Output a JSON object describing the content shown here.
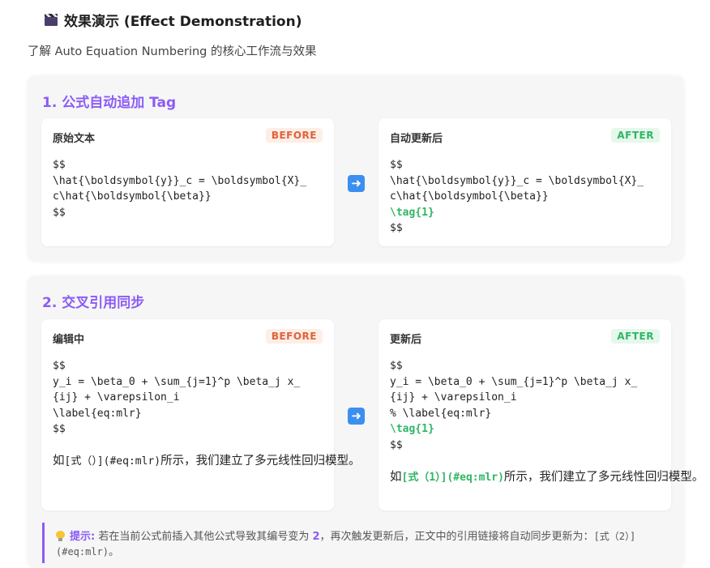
{
  "header": {
    "icon": "clapperboard-icon",
    "title": "效果演示 (Effect Demonstration)"
  },
  "subtitle": "了解 Auto Equation Numbering 的核心工作流与效果",
  "sections": [
    {
      "title": "1. 公式自动追加 Tag",
      "before": {
        "label": "原始文本",
        "badge": "BEFORE",
        "lines": [
          "$$",
          "\\hat{\\boldsymbol{y}}_c = \\boldsymbol{X}_",
          "c\\hat{\\boldsymbol{\\beta}}",
          "$$"
        ]
      },
      "arrow_icon": "right-arrow-icon",
      "after": {
        "label": "自动更新后",
        "badge": "AFTER",
        "lines": [
          "$$",
          "\\hat{\\boldsymbol{y}}_c = \\boldsymbol{X}_",
          "c\\hat{\\boldsymbol{\\beta}}"
        ],
        "highlight_line": "\\tag{1}",
        "end_line": "$$"
      }
    },
    {
      "title": "2. 交叉引用同步",
      "before": {
        "label": "编辑中",
        "badge": "BEFORE",
        "lines": [
          "$$",
          "y_i = \\beta_0 + \\sum_{j=1}^p \\beta_j x_",
          "{ij} + \\varepsilon_i",
          "\\label{eq:mlr}",
          "$$"
        ],
        "prose_prefix": "如",
        "prose_link": "[式（）](#eq:mlr)",
        "prose_suffix": "所示，我们建立了多元线性回归模型。"
      },
      "arrow_icon": "right-arrow-icon",
      "after": {
        "label": "更新后",
        "badge": "AFTER",
        "lines": [
          "$$",
          "y_i = \\beta_0 + \\sum_{j=1}^p \\beta_j x_",
          "{ij} + \\varepsilon_i",
          "% \\label{eq:mlr}"
        ],
        "highlight_line": "\\tag{1}",
        "end_line": "$$",
        "prose_prefix": "如",
        "prose_link": "[式（1）](#eq:mlr)",
        "prose_suffix": "所示，我们建立了多元线性回归模型。"
      }
    }
  ],
  "tip": {
    "icon": "lightbulb-icon",
    "label": "提示:",
    "text_1": "若在当前公式前插入其他公式导致其编号变为",
    "number": "2",
    "text_2": "，再次触发更新后，正文中的引用链接将自动同步更新为：",
    "code": "[式（2）](#eq:mlr)",
    "end": "。"
  },
  "colors": {
    "accent": "#8b5cf6",
    "before": "#e0623a",
    "after": "#2eb664",
    "arrow": "#3b8ff0"
  }
}
